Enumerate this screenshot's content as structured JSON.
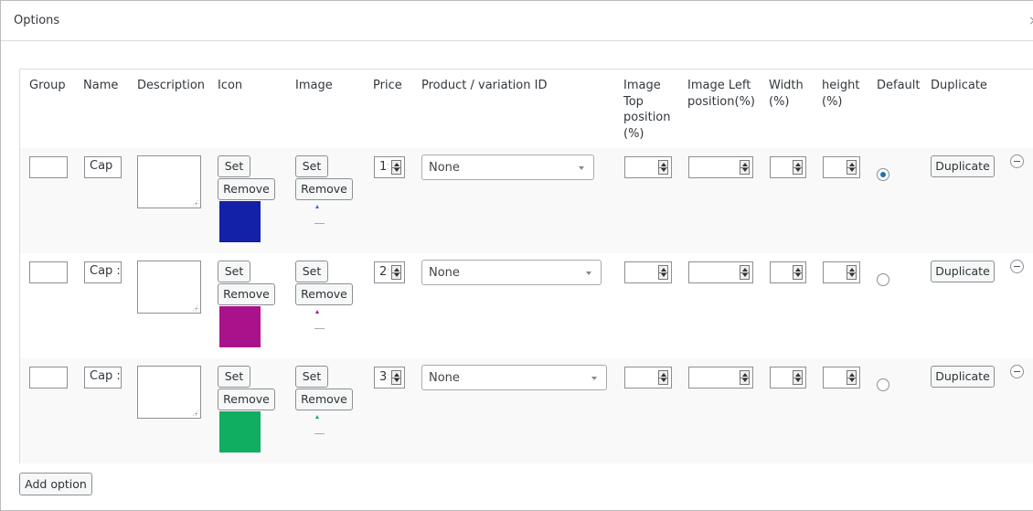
{
  "modal": {
    "title": "Options",
    "close_label": "×"
  },
  "columns": {
    "group": "Group",
    "name": "Name",
    "description": "Description",
    "icon": "Icon",
    "image": "Image",
    "price": "Price",
    "product": "Product / variation ID",
    "img_top_1": "Image",
    "img_top_2": "Top",
    "img_top_3": "position",
    "img_top_4": "(%)",
    "img_left_1": "Image Left",
    "img_left_2": "position(%)",
    "width_1": "Width",
    "width_2": "(%)",
    "height_1": "height",
    "height_2": "(%)",
    "default": "Default",
    "duplicate": "Duplicate"
  },
  "rows": [
    {
      "group": "",
      "name": "Cap",
      "set_label": "Set",
      "remove_label": "Remove",
      "icon_color": "#1320a8",
      "image_accent": "#3a6fc4",
      "price": "1:",
      "product": "None",
      "duplicate_label": "Duplicate",
      "default": true
    },
    {
      "group": "",
      "name": "Cap :",
      "set_label": "Set",
      "remove_label": "Remove",
      "icon_color": "#a9128a",
      "image_accent": "#a9128a",
      "price": "2:",
      "product": "None",
      "duplicate_label": "Duplicate",
      "default": false
    },
    {
      "group": "",
      "name": "Cap :",
      "set_label": "Set",
      "remove_label": "Remove",
      "icon_color": "#0fae61",
      "image_accent": "#0fae61",
      "price": "3:",
      "product": "None",
      "duplicate_label": "Duplicate",
      "default": false
    }
  ],
  "footer": {
    "add_option_label": "Add option"
  }
}
